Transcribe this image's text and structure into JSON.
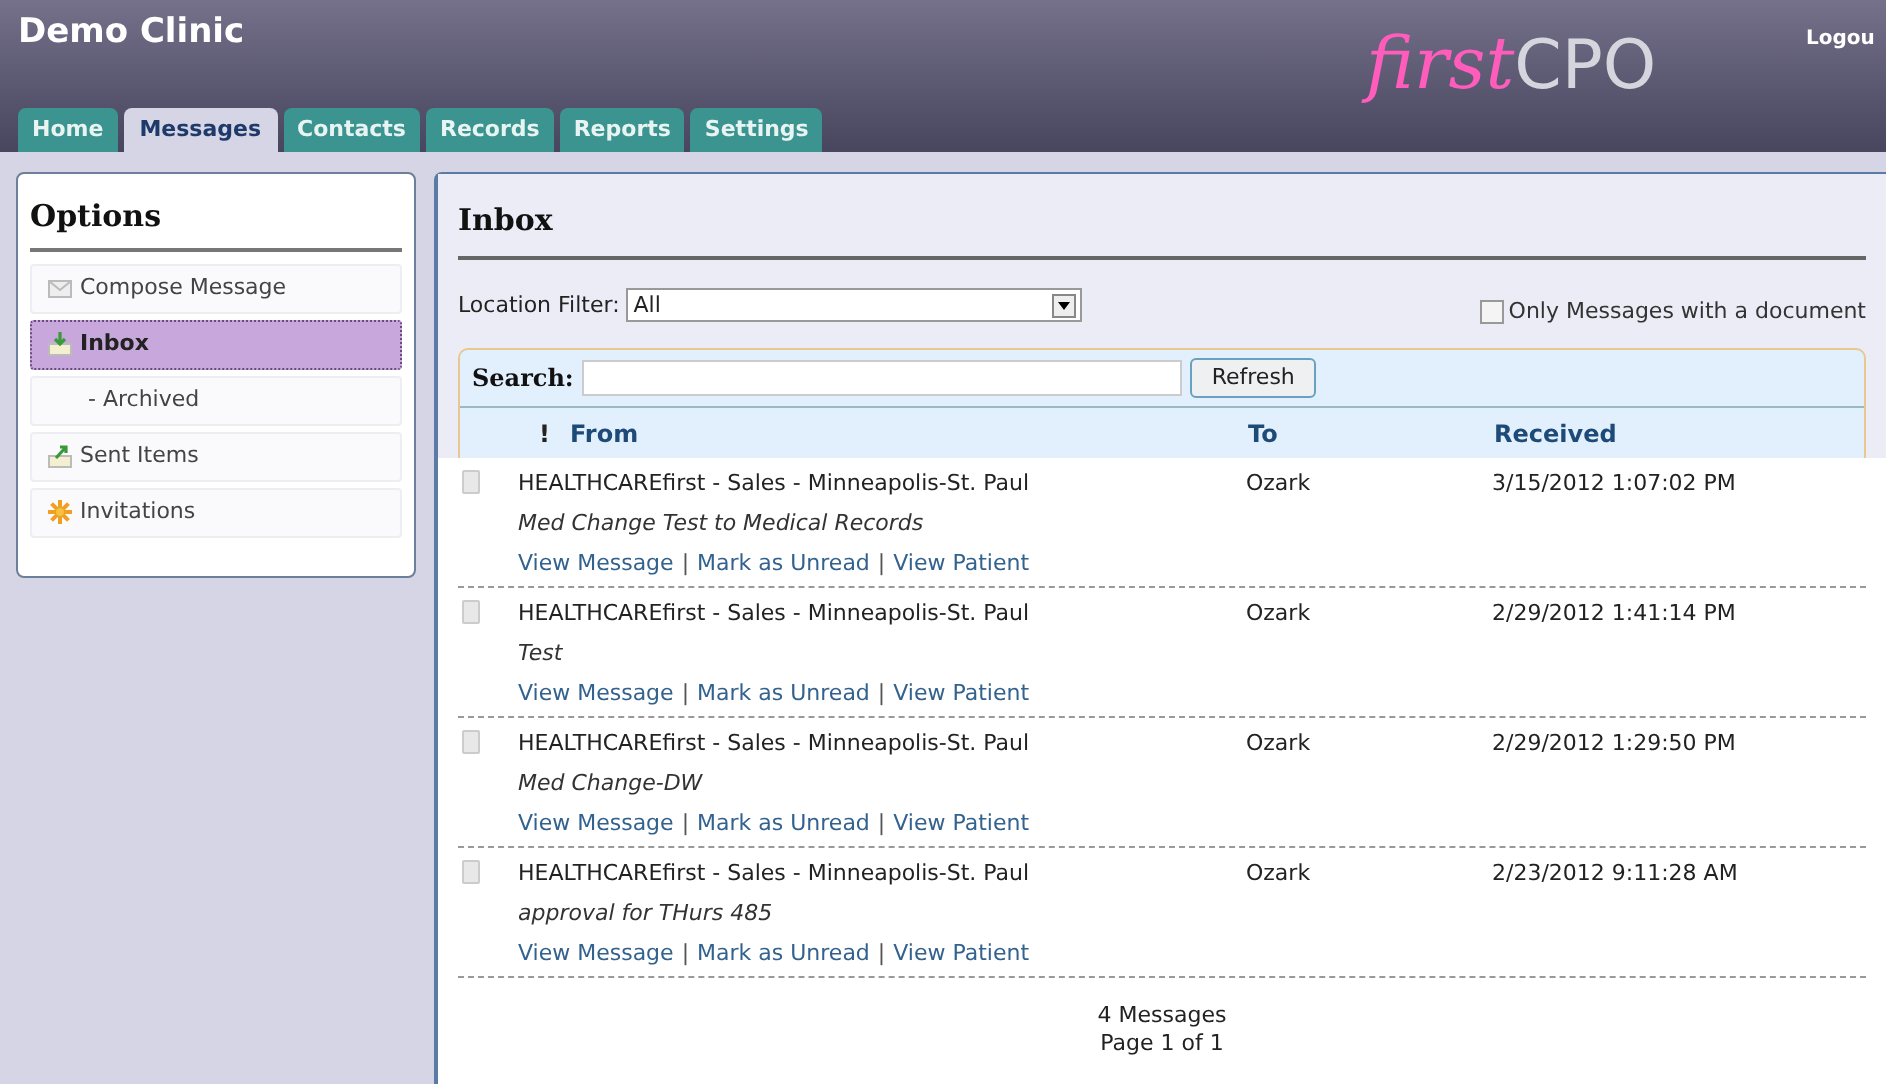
{
  "header": {
    "title": "Demo Clinic",
    "logo": {
      "script": "first",
      "text": "CPO"
    },
    "logout": "Logou"
  },
  "tabs": [
    {
      "label": "Home",
      "selected": false
    },
    {
      "label": "Messages",
      "selected": true
    },
    {
      "label": "Contacts",
      "selected": false
    },
    {
      "label": "Records",
      "selected": false
    },
    {
      "label": "Reports",
      "selected": false
    },
    {
      "label": "Settings",
      "selected": false
    }
  ],
  "sidebar": {
    "title": "Options",
    "items": [
      {
        "label": "Compose Message",
        "kind": "compose",
        "selected": false
      },
      {
        "label": "Inbox",
        "kind": "inbox",
        "selected": true
      },
      {
        "label": "- Archived",
        "kind": "sub",
        "selected": false
      },
      {
        "label": "Sent Items",
        "kind": "sent",
        "selected": false
      },
      {
        "label": "Invitations",
        "kind": "invite",
        "selected": false
      }
    ]
  },
  "inbox": {
    "title": "Inbox",
    "location_filter": {
      "label": "Location Filter:",
      "value": "All"
    },
    "document_filter": {
      "label": "Only Messages with a document",
      "checked": false
    },
    "search": {
      "label": "Search:",
      "button": "Refresh"
    },
    "columns": [
      "!",
      "From",
      "To",
      "Received"
    ],
    "separator": "|",
    "messages": [
      {
        "from": "HEALTHCAREfirst - Sales - Minneapolis-St. Paul",
        "subject": "Med Change Test to Medical Records",
        "to": "Ozark",
        "received": "3/15/2012 1:07:02 PM",
        "links": [
          "View Message",
          "Mark as Unread",
          "View Patient"
        ]
      },
      {
        "from": "HEALTHCAREfirst - Sales - Minneapolis-St. Paul",
        "subject": "Test",
        "to": "Ozark",
        "received": "2/29/2012 1:41:14 PM",
        "links": [
          "View Message",
          "Mark as Unread",
          "View Patient"
        ]
      },
      {
        "from": "HEALTHCAREfirst - Sales - Minneapolis-St. Paul",
        "subject": "Med Change-DW",
        "to": "Ozark",
        "received": "2/29/2012 1:29:50 PM",
        "links": [
          "View Message",
          "Mark as Unread",
          "View Patient"
        ]
      },
      {
        "from": "HEALTHCAREfirst - Sales - Minneapolis-St. Paul",
        "subject": "approval for THurs 485",
        "to": "Ozark",
        "received": "2/23/2012 9:11:28 AM",
        "links": [
          "View Message",
          "Mark as Unread",
          "View Patient"
        ]
      }
    ],
    "footer": {
      "count": "4 Messages",
      "page": "Page 1 of 1"
    }
  }
}
